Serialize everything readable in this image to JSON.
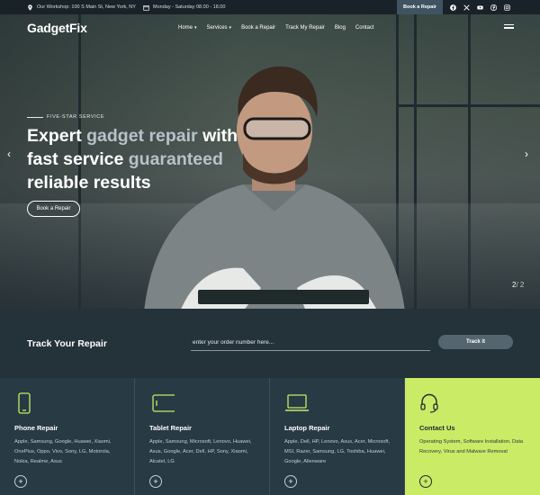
{
  "topbar": {
    "address": "Our Workshop: 100 S Main St, New York, NY",
    "hours": "Monday - Saturday 08.00 - 18.00",
    "book_label": "Book a Repair",
    "social_icons": [
      "facebook-icon",
      "x-icon",
      "youtube-icon",
      "pinterest-icon",
      "instagram-icon"
    ]
  },
  "nav": {
    "logo": "GadgetFix",
    "items": [
      {
        "label": "Home",
        "dropdown": true
      },
      {
        "label": "Services",
        "dropdown": true
      },
      {
        "label": "Book a Repair",
        "dropdown": false
      },
      {
        "label": "Track My Repair",
        "dropdown": false
      },
      {
        "label": "Blog",
        "dropdown": false
      },
      {
        "label": "Contact",
        "dropdown": false
      }
    ]
  },
  "hero": {
    "eyebrow": "FIVE-STAR SERVICE",
    "headline_1a": "Expert ",
    "headline_1b": "gadget repair",
    "headline_1c": " with",
    "headline_2a": "fast service ",
    "headline_2b": "guaranteed",
    "headline_3": "reliable results",
    "button_label": "Book a Repair",
    "slide_current": "2",
    "slide_total": "/ 2"
  },
  "track": {
    "title": "Track Your Repair",
    "placeholder": "enter your order number here...",
    "button_label": "Track it"
  },
  "cards": [
    {
      "title": "Phone Repair",
      "desc": "Apple, Samsung, Google, Huawei, Xiaomi, OnePlus, Oppo, Vivo, Sony, LG, Motorola, Nokia, Realme, Asus",
      "icon": "phone-icon"
    },
    {
      "title": "Tablet Repair",
      "desc": "Apple, Samsung, Microsoft, Lenovo, Huawei, Asus, Google, Acer, Dell, HP, Sony, Xiaomi, Alcatel, LG",
      "icon": "tablet-icon"
    },
    {
      "title": "Laptop Repair",
      "desc": "Apple, Dell, HP, Lenovo, Asus, Acer, Microsoft, MSI, Razer, Samsung, LG, Toshiba, Huawei, Google, Alienware",
      "icon": "laptop-icon"
    },
    {
      "title": "Contact Us",
      "desc": "Operating System, Software Installation, Data Recovery, Virus and Malware Removal",
      "icon": "headset-icon"
    }
  ],
  "colors": {
    "accent": "#c9eb66",
    "dark": "#24323a",
    "card": "#283a44"
  }
}
